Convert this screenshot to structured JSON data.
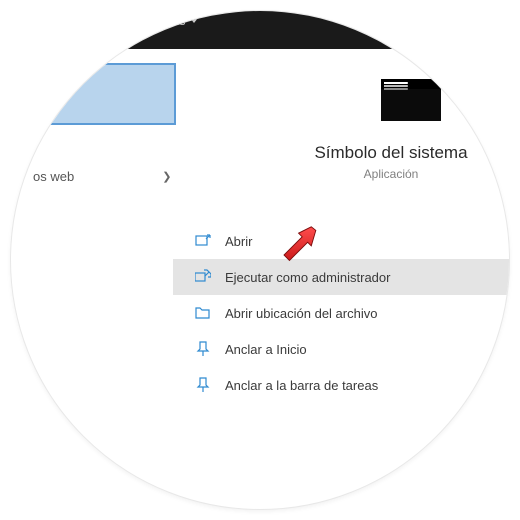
{
  "topbar": {
    "more_label": "Más"
  },
  "sidebar": {
    "web_docs_label": "os web"
  },
  "preview": {
    "title": "Símbolo del sistema",
    "subtitle": "Aplicación"
  },
  "actions": {
    "open": "Abrir",
    "run_admin": "Ejecutar como administrador",
    "open_location": "Abrir ubicación del archivo",
    "pin_start": "Anclar a Inicio",
    "pin_taskbar": "Anclar a la barra de tareas"
  }
}
